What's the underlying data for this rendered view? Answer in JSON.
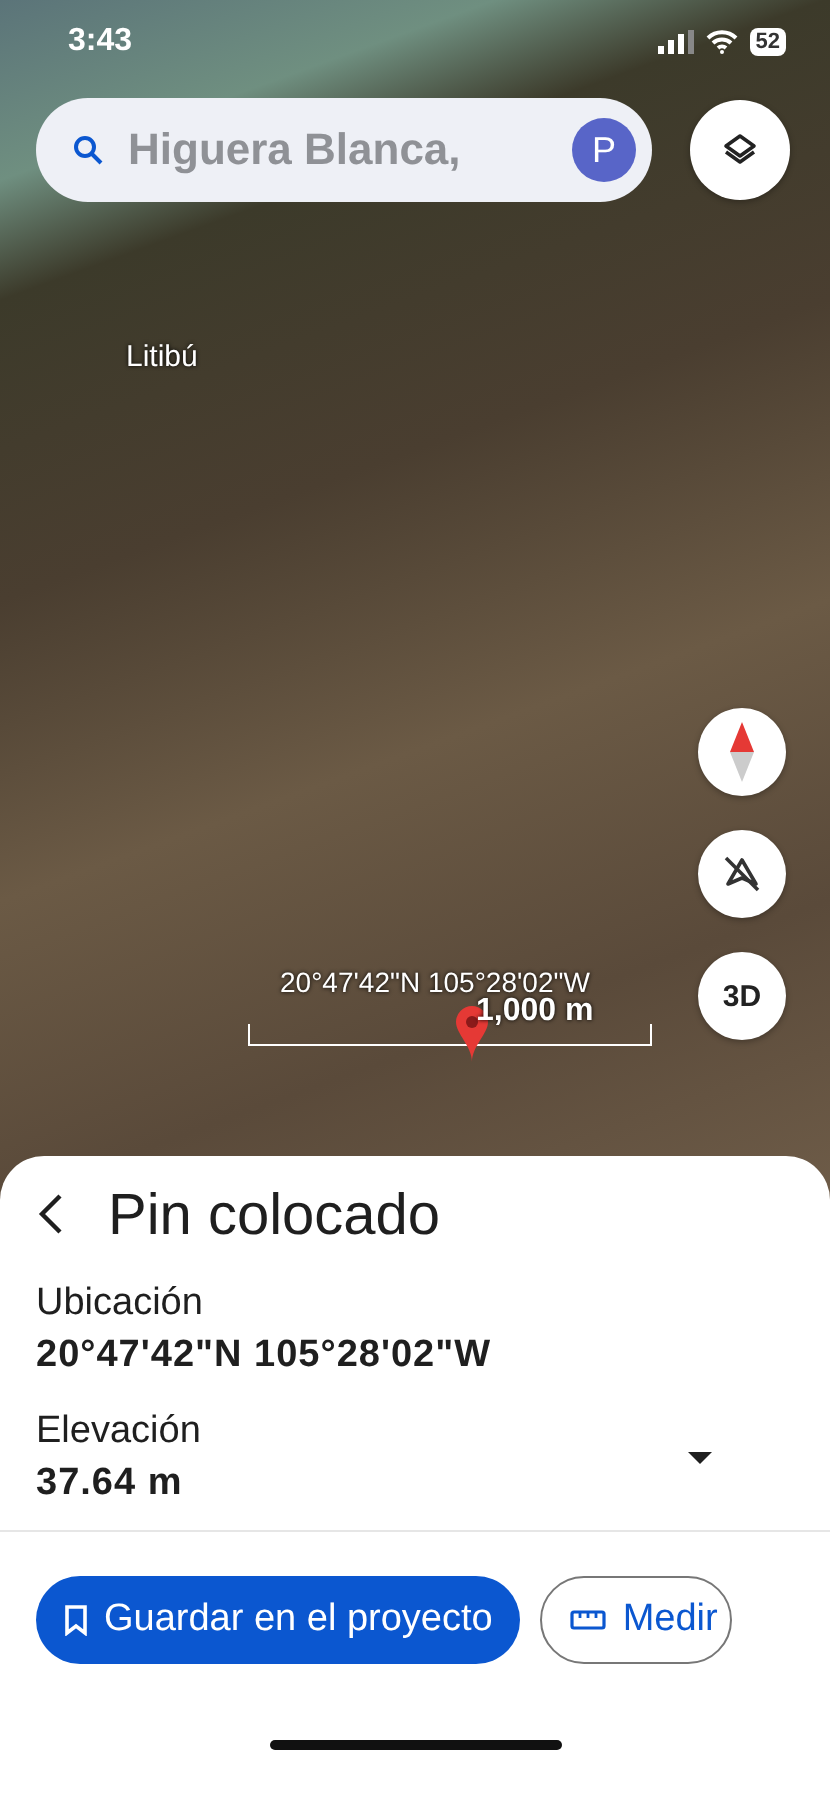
{
  "status_bar": {
    "time": "3:43",
    "battery": "52"
  },
  "search": {
    "value": "Higuera Blanca,",
    "avatar": "P"
  },
  "map": {
    "labels": [
      "Litibú"
    ],
    "coordinates": "20°47'42\"N 105°28'02\"W",
    "scale": "1,000 m",
    "view_button": "3D"
  },
  "sheet": {
    "title": "Pin colocado",
    "fields": [
      {
        "label": "Ubicación",
        "value": "20°47'42\"N 105°28'02\"W"
      },
      {
        "label": "Elevación",
        "value": "37.64 m",
        "expanded": false
      }
    ]
  },
  "buttons": [
    {
      "kind": "primary",
      "label": "Guardar en el proyecto"
    },
    {
      "kind": "outlined",
      "label": "Medir"
    }
  ]
}
